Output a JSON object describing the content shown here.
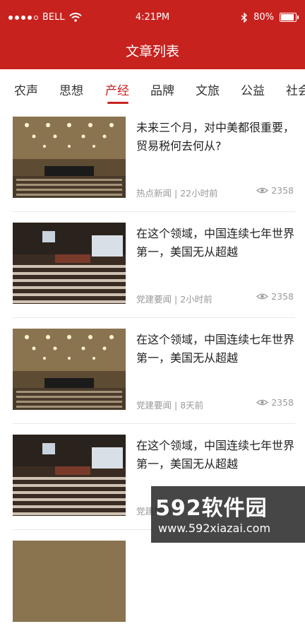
{
  "status_bar": {
    "carrier": "BELL",
    "time": "4:21PM",
    "battery": "80%",
    "battery_level": 0.8
  },
  "header": {
    "title": "文章列表"
  },
  "tabs": [
    {
      "label": "农声"
    },
    {
      "label": "思想"
    },
    {
      "label": "产经"
    },
    {
      "label": "品牌"
    },
    {
      "label": "文旅"
    },
    {
      "label": "公益"
    },
    {
      "label": "社会"
    }
  ],
  "articles": [
    {
      "title": "未来三个月，对中美都很重要，贸易税何去何从?",
      "source": "热点新闻",
      "time": "22小时前",
      "views": "2358"
    },
    {
      "title": "在这个领域，中国连续七年世界第一，美国无从超越",
      "source": "党建要闻",
      "time": "2小时前",
      "views": "2358"
    },
    {
      "title": "在这个领域，中国连续七年世界第一，美国无从超越",
      "source": "党建要闻",
      "time": "8天前",
      "views": "2358"
    },
    {
      "title": "在这个领域，中国连续七年世界第一，美国无从超越",
      "source": "党建要闻",
      "time": "",
      "views": ""
    }
  ],
  "watermark": {
    "brand": "592软件园",
    "url": "www.592xiazai.com"
  }
}
